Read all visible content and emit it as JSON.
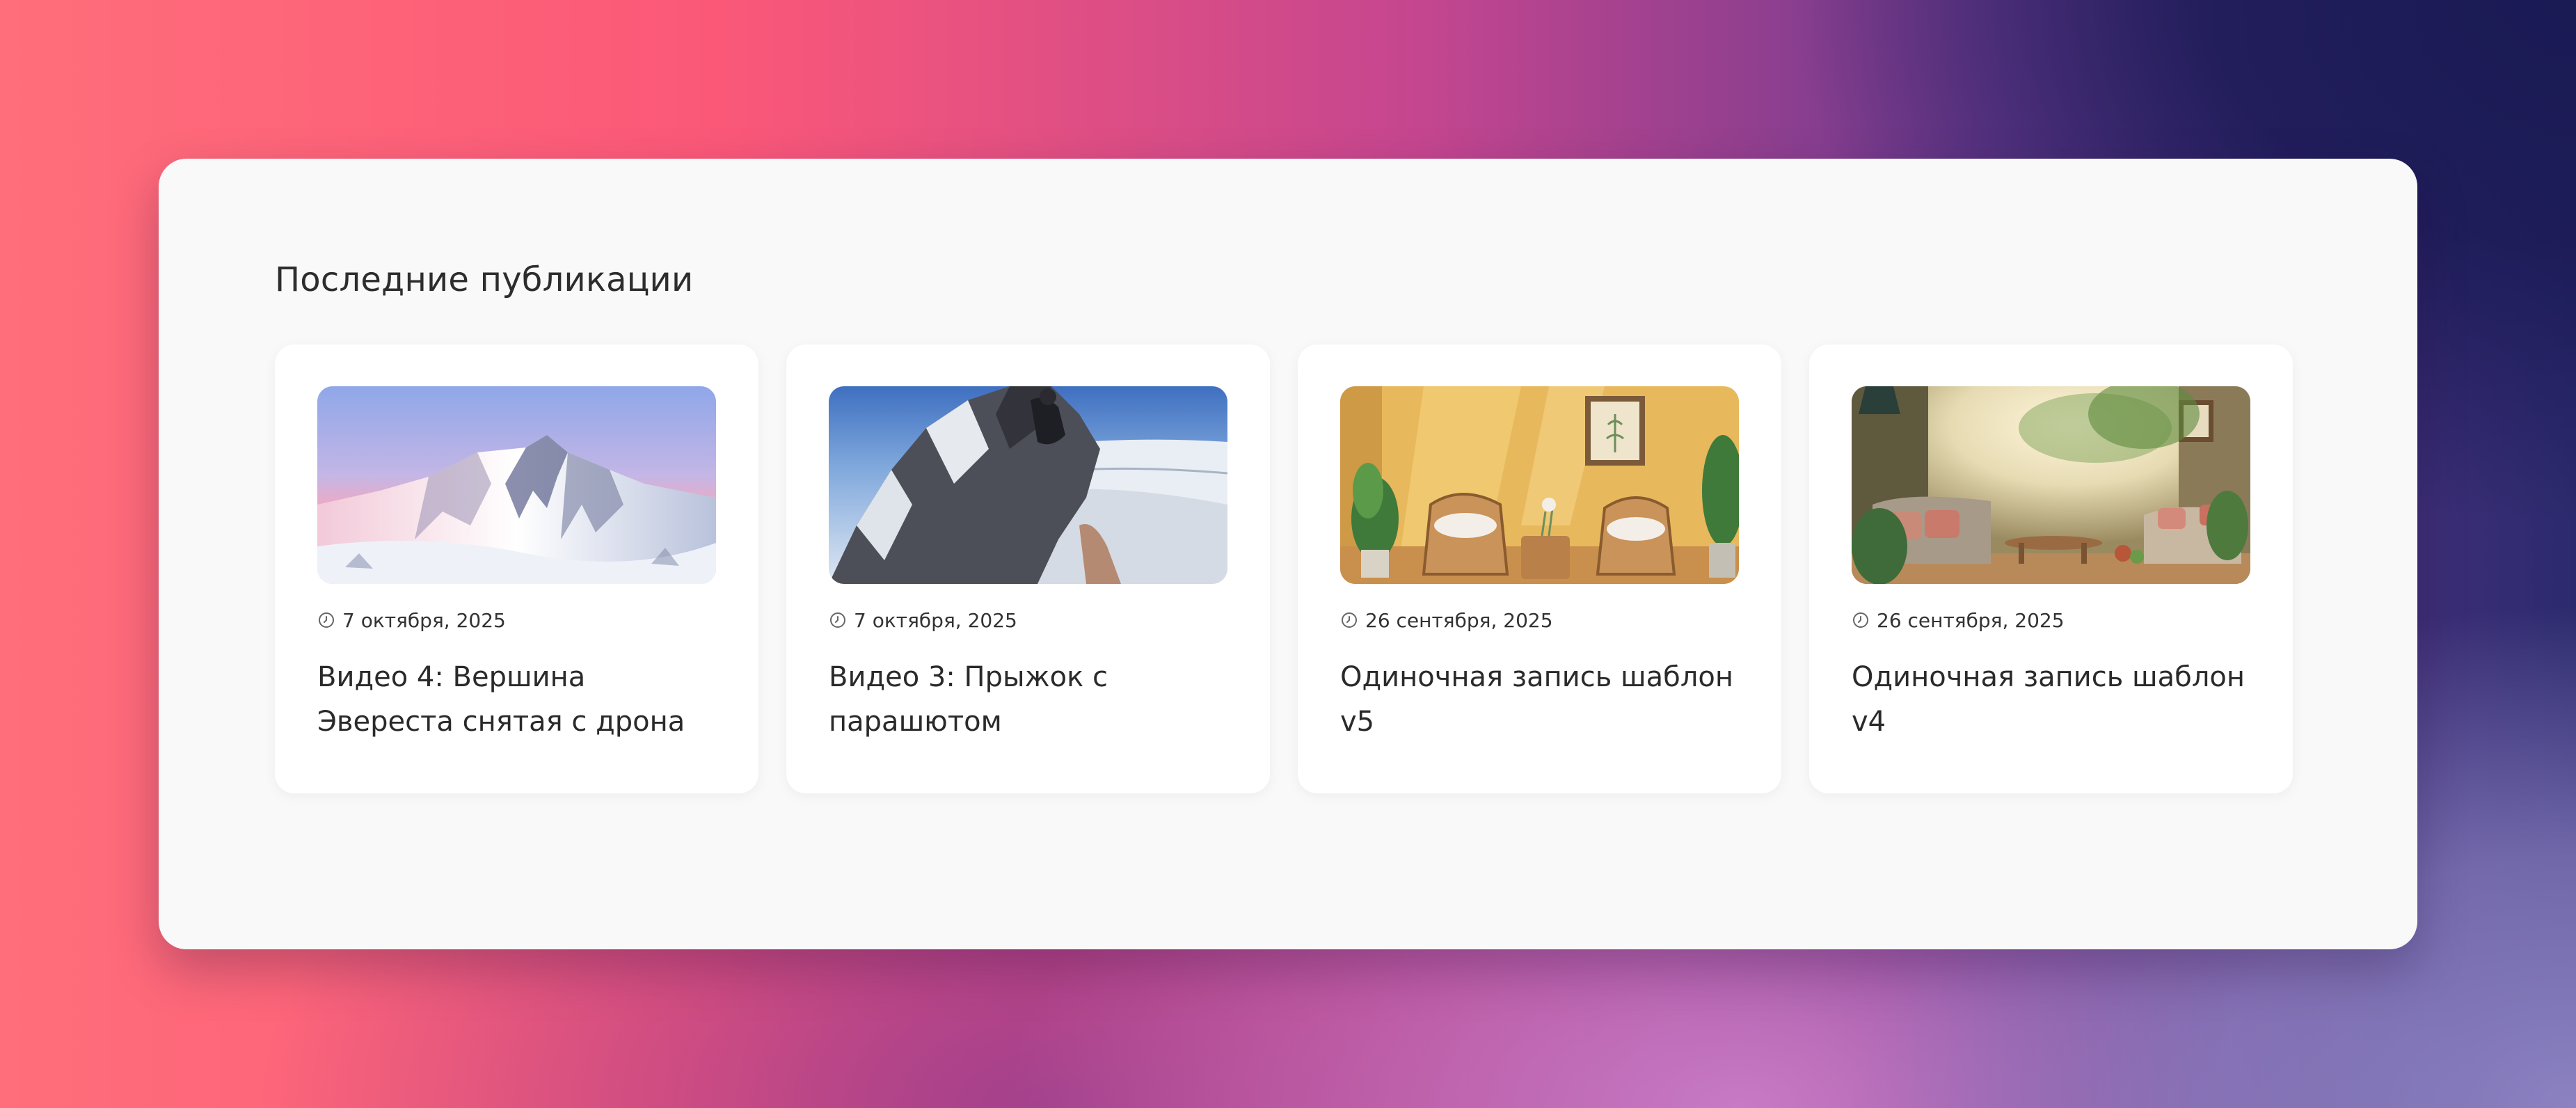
{
  "section": {
    "title": "Последние публикации"
  },
  "posts": [
    {
      "date": "7 октября, 2025",
      "title": "Видео 4: Вершина Эвереста снятая с дрона",
      "image": "mountain-summit-image"
    },
    {
      "date": "7 октября, 2025",
      "title": "Видео 3: Прыжок с парашютом",
      "image": "climber-on-ridge-image"
    },
    {
      "date": "26 сентября, 2025",
      "title": "Одиночная запись шаблон v5",
      "image": "yellow-room-chairs-image"
    },
    {
      "date": "26 сентября, 2025",
      "title": "Одиночная запись шаблон v4",
      "image": "sunlit-living-room-image"
    }
  ],
  "icons": {
    "date": "clock-icon"
  },
  "colors": {
    "panel_background": "#f9f9f9",
    "card_background": "#ffffff",
    "text": "#2a2a2a"
  }
}
